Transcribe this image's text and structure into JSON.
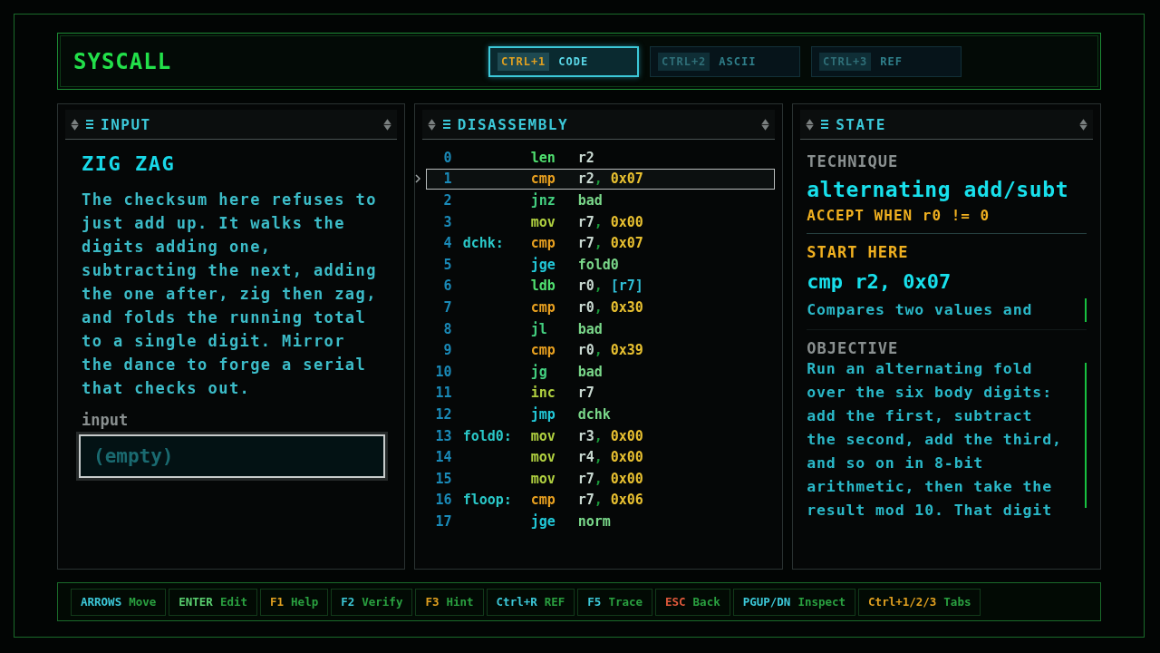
{
  "app": {
    "title": "SYSCALL"
  },
  "tabs": [
    {
      "key": "CTRL+1",
      "label": "CODE",
      "selected": true
    },
    {
      "key": "CTRL+2",
      "label": "ASCII",
      "selected": false
    },
    {
      "key": "CTRL+3",
      "label": "REF",
      "selected": false
    }
  ],
  "input_panel": {
    "title": "INPUT",
    "heading": "ZIG ZAG",
    "description": [
      "The checksum here refuses to",
      "just add up. It walks the",
      "digits adding one,",
      "subtracting the next, adding",
      "the one after, zig then zag,",
      "and folds the running total",
      "to a single digit. Mirror",
      "the dance to forge a serial",
      "that checks out."
    ],
    "field_label": "input",
    "field": {
      "placeholder": "(empty)"
    }
  },
  "disassembly": {
    "title": "DISASSEMBLY",
    "rows": [
      {
        "num": "0",
        "label": "",
        "op": "len",
        "kind": "load",
        "selected": false,
        "args": [
          {
            "t": "r2",
            "kind": "reg"
          }
        ]
      },
      {
        "num": "1",
        "label": "",
        "op": "cmp",
        "kind": "compare",
        "selected": true,
        "args": [
          {
            "t": "r2",
            "kind": "reg"
          },
          {
            "t": ",",
            "kind": "sep"
          },
          {
            "t": "0x07",
            "kind": "imm"
          }
        ]
      },
      {
        "num": "2",
        "label": "",
        "op": "jnz",
        "kind": "branch",
        "selected": false,
        "args": [
          {
            "t": "bad",
            "kind": "target"
          }
        ]
      },
      {
        "num": "3",
        "label": "",
        "op": "mov",
        "kind": "move",
        "selected": false,
        "args": [
          {
            "t": "r7",
            "kind": "reg"
          },
          {
            "t": ",",
            "kind": "sep"
          },
          {
            "t": "0x00",
            "kind": "imm"
          }
        ]
      },
      {
        "num": "4",
        "label": "dchk:",
        "op": "cmp",
        "kind": "compare",
        "selected": false,
        "args": [
          {
            "t": "r7",
            "kind": "reg"
          },
          {
            "t": ",",
            "kind": "sep"
          },
          {
            "t": "0x07",
            "kind": "imm"
          }
        ]
      },
      {
        "num": "5",
        "label": "",
        "op": "jge",
        "kind": "jump",
        "selected": false,
        "args": [
          {
            "t": "fold0",
            "kind": "target"
          }
        ]
      },
      {
        "num": "6",
        "label": "",
        "op": "ldb",
        "kind": "load",
        "selected": false,
        "args": [
          {
            "t": "r0",
            "kind": "reg"
          },
          {
            "t": ",",
            "kind": "sep"
          },
          {
            "t": "[r7]",
            "kind": "mem"
          }
        ]
      },
      {
        "num": "7",
        "label": "",
        "op": "cmp",
        "kind": "compare",
        "selected": false,
        "args": [
          {
            "t": "r0",
            "kind": "reg"
          },
          {
            "t": ",",
            "kind": "sep"
          },
          {
            "t": "0x30",
            "kind": "imm"
          }
        ]
      },
      {
        "num": "8",
        "label": "",
        "op": "jl",
        "kind": "branch",
        "selected": false,
        "args": [
          {
            "t": "bad",
            "kind": "target"
          }
        ]
      },
      {
        "num": "9",
        "label": "",
        "op": "cmp",
        "kind": "compare",
        "selected": false,
        "args": [
          {
            "t": "r0",
            "kind": "reg"
          },
          {
            "t": ",",
            "kind": "sep"
          },
          {
            "t": "0x39",
            "kind": "imm"
          }
        ]
      },
      {
        "num": "10",
        "label": "",
        "op": "jg",
        "kind": "branch",
        "selected": false,
        "args": [
          {
            "t": "bad",
            "kind": "target"
          }
        ]
      },
      {
        "num": "11",
        "label": "",
        "op": "inc",
        "kind": "move",
        "selected": false,
        "args": [
          {
            "t": "r7",
            "kind": "reg"
          }
        ]
      },
      {
        "num": "12",
        "label": "",
        "op": "jmp",
        "kind": "jump",
        "selected": false,
        "args": [
          {
            "t": "dchk",
            "kind": "target"
          }
        ]
      },
      {
        "num": "13",
        "label": "fold0:",
        "op": "mov",
        "kind": "move",
        "selected": false,
        "args": [
          {
            "t": "r3",
            "kind": "reg"
          },
          {
            "t": ",",
            "kind": "sep"
          },
          {
            "t": "0x00",
            "kind": "imm"
          }
        ]
      },
      {
        "num": "14",
        "label": "",
        "op": "mov",
        "kind": "move",
        "selected": false,
        "args": [
          {
            "t": "r4",
            "kind": "reg"
          },
          {
            "t": ",",
            "kind": "sep"
          },
          {
            "t": "0x00",
            "kind": "imm"
          }
        ]
      },
      {
        "num": "15",
        "label": "",
        "op": "mov",
        "kind": "move",
        "selected": false,
        "args": [
          {
            "t": "r7",
            "kind": "reg"
          },
          {
            "t": ",",
            "kind": "sep"
          },
          {
            "t": "0x00",
            "kind": "imm"
          }
        ]
      },
      {
        "num": "16",
        "label": "floop:",
        "op": "cmp",
        "kind": "compare",
        "selected": false,
        "args": [
          {
            "t": "r7",
            "kind": "reg"
          },
          {
            "t": ",",
            "kind": "sep"
          },
          {
            "t": "0x06",
            "kind": "imm"
          }
        ]
      },
      {
        "num": "17",
        "label": "",
        "op": "jge",
        "kind": "jump",
        "selected": false,
        "args": [
          {
            "t": "norm",
            "kind": "target"
          }
        ]
      }
    ]
  },
  "state_panel": {
    "title": "STATE",
    "technique_label": "TECHNIQUE",
    "technique": "alternating add/subt",
    "accept": "ACCEPT WHEN r0 != 0",
    "start_label": "START HERE",
    "start_instruction": "cmp r2, 0x07",
    "start_note": [
      "Compares two values and"
    ],
    "objective_label": "OBJECTIVE",
    "objective": [
      "Run an alternating fold",
      "over the six body digits:",
      "add the first, subtract",
      "the second, add the third,",
      "and so on in 8-bit",
      "arithmetic, then take the",
      "result mod 10. That digit"
    ]
  },
  "hotkeys": [
    {
      "key": "ARROWS",
      "action": "Move",
      "color": "#3cc8d8"
    },
    {
      "key": "ENTER",
      "action": "Edit",
      "color": "#5ad070"
    },
    {
      "key": "F1",
      "action": "Help",
      "color": "#e0a020"
    },
    {
      "key": "F2",
      "action": "Verify",
      "color": "#3cc8d8"
    },
    {
      "key": "F3",
      "action": "Hint",
      "color": "#e0a020"
    },
    {
      "key": "Ctrl+R",
      "action": "REF",
      "color": "#3cc8d8"
    },
    {
      "key": "F5",
      "action": "Trace",
      "color": "#3cc8d8"
    },
    {
      "key": "ESC",
      "action": "Back",
      "color": "#e05a3c"
    },
    {
      "key": "PGUP/DN",
      "action": "Inspect",
      "color": "#3cc8d8"
    },
    {
      "key": "Ctrl+1/2/3",
      "action": "Tabs",
      "color": "#e0a020"
    }
  ]
}
